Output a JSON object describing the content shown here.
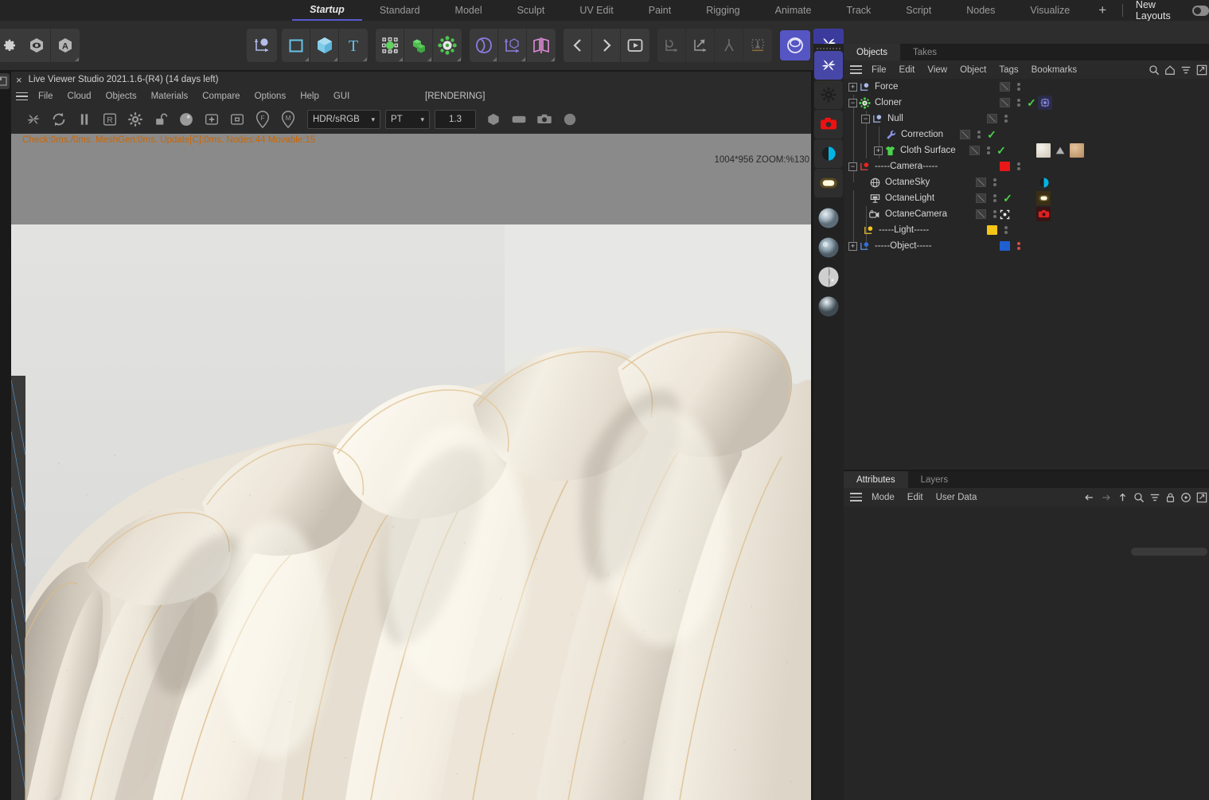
{
  "layout_tabs": {
    "items": [
      {
        "label": "Startup",
        "active": true
      },
      {
        "label": "Standard",
        "active": false
      },
      {
        "label": "Model",
        "active": false
      },
      {
        "label": "Sculpt",
        "active": false
      },
      {
        "label": "UV Edit",
        "active": false
      },
      {
        "label": "Paint",
        "active": false
      },
      {
        "label": "Rigging",
        "active": false
      },
      {
        "label": "Animate",
        "active": false
      },
      {
        "label": "Track",
        "active": false
      },
      {
        "label": "Script",
        "active": false
      },
      {
        "label": "Nodes",
        "active": false
      },
      {
        "label": "Visualize",
        "active": false
      }
    ],
    "add_label": "+",
    "new_layouts_label": "New Layouts"
  },
  "main_toolbar": {
    "groups": [
      {
        "name": "settings",
        "buttons": [
          {
            "icon": "gear-icon"
          }
        ]
      },
      {
        "name": "viewport-toggles",
        "buttons": [
          {
            "icon": "eye-icon"
          },
          {
            "icon": "letter-a-icon"
          }
        ]
      },
      {
        "name": "axis",
        "buttons": [
          {
            "icon": "axis-object-icon"
          }
        ]
      },
      {
        "name": "primitives",
        "buttons": [
          {
            "icon": "square-spline-icon"
          },
          {
            "icon": "cube-icon"
          },
          {
            "icon": "text-tool-icon"
          }
        ]
      },
      {
        "name": "generators",
        "buttons": [
          {
            "icon": "deformer-icon"
          },
          {
            "icon": "array-icon"
          },
          {
            "icon": "mograph-icon"
          }
        ]
      },
      {
        "name": "modifiers",
        "buttons": [
          {
            "icon": "spline-mask-icon"
          },
          {
            "icon": "coord-cube-icon"
          },
          {
            "icon": "plane-mirror-icon"
          }
        ]
      },
      {
        "name": "navigation",
        "buttons": [
          {
            "icon": "prev-frame-icon"
          },
          {
            "icon": "next-frame-icon"
          },
          {
            "icon": "render-view-icon"
          }
        ]
      },
      {
        "name": "transform",
        "buttons": [
          {
            "icon": "rotate-axis-icon"
          },
          {
            "icon": "scale-axis-icon"
          },
          {
            "icon": "merge-icon"
          },
          {
            "icon": "drop-icon"
          }
        ]
      },
      {
        "name": "render",
        "buttons": [
          {
            "icon": "render-sphere-icon"
          }
        ]
      },
      {
        "name": "octane",
        "buttons": [
          {
            "icon": "octane-logo-icon"
          }
        ]
      }
    ]
  },
  "live_viewer": {
    "title": "Live Viewer Studio 2021.1.6-(R4) (14 days left)",
    "close_label": "×",
    "menus": [
      "File",
      "Cloud",
      "Objects",
      "Materials",
      "Compare",
      "Options",
      "Help",
      "GUI"
    ],
    "rendering_status": "[RENDERING]",
    "toolbar_icons": [
      "octane-restart-icon",
      "refresh-icon",
      "pause-icon",
      "region-render-icon",
      "render-settings-icon",
      "lock-unlocked-icon",
      "sphere-preview-icon",
      "add-region-icon",
      "clear-region-icon",
      "focus-picker-icon",
      "material-picker-icon"
    ],
    "color_space": {
      "value": "HDR/sRGB",
      "chevron": "⌄"
    },
    "kernel": {
      "value": "PT",
      "chevron": "⌄"
    },
    "exposure": {
      "value": "1.3"
    },
    "right_icons": [
      "hexagon-icon",
      "rounded-rect-icon",
      "camera-icon",
      "circle-icon"
    ],
    "status_text": "Check:0ms./0ms. MeshGen:0ms. Update[C]:0ms. Nodes:44 Movable:15",
    "resolution_zoom": "1004*956 ZOOM:%130"
  },
  "vertical_strip": {
    "items": [
      {
        "name": "octane-logo-icon",
        "selected": true
      },
      {
        "name": "gear-icon",
        "selected": false
      },
      {
        "name": "camera-icon",
        "selected": false
      },
      {
        "name": "contrast-circle-icon",
        "selected": false
      },
      {
        "name": "light-icon",
        "selected": false
      },
      {
        "name": "material-sphere-1-icon",
        "selected": false
      },
      {
        "name": "material-sphere-2-icon",
        "selected": false
      },
      {
        "name": "material-sphere-3-icon",
        "selected": false
      },
      {
        "name": "material-sphere-4-icon",
        "selected": false
      }
    ]
  },
  "object_manager": {
    "tabs": [
      {
        "label": "Objects",
        "active": true
      },
      {
        "label": "Takes",
        "active": false
      }
    ],
    "menus": [
      "File",
      "Edit",
      "View",
      "Object",
      "Tags",
      "Bookmarks"
    ],
    "header_icons": [
      "search-icon",
      "home-icon",
      "filter-icon",
      "expand-icon"
    ],
    "tree": [
      {
        "label": "Force",
        "depth": 0,
        "expander": "+",
        "icon": "null-object-icon",
        "icon_color": "#a9b6e8",
        "checkbox": true,
        "dots": "gray",
        "visible_tick": false,
        "color_box": null,
        "tags": []
      },
      {
        "label": "Cloner",
        "depth": 0,
        "expander": "-",
        "icon": "mograph-cloner-icon",
        "icon_color": "#4ad24a",
        "checkbox": true,
        "dots": "gray",
        "visible_tick": true,
        "color_box": null,
        "tags": [
          {
            "type": "mograph-tag",
            "color": "#6a6ad8"
          }
        ]
      },
      {
        "label": "Null",
        "depth": 1,
        "expander": "-",
        "icon": "null-object-icon",
        "icon_color": "#a9b6e8",
        "checkbox": true,
        "dots": "gray",
        "visible_tick": false,
        "color_box": null,
        "tags": []
      },
      {
        "label": "Correction",
        "depth": 2,
        "expander": "",
        "icon": "wrench-icon",
        "icon_color": "#8a95e8",
        "checkbox": true,
        "dots": "gray",
        "visible_tick": true,
        "color_box": null,
        "tags": []
      },
      {
        "label": "Cloth Surface",
        "depth": 2,
        "expander": "+",
        "icon": "cloth-shirt-icon",
        "icon_color": "#4ad24a",
        "checkbox": true,
        "dots": "gray",
        "visible_tick": true,
        "color_box": null,
        "tags": [
          {
            "type": "material-thumb-white",
            "color": "#e4ddd3"
          },
          {
            "type": "phong-triangle-tag",
            "color": "#9a9a9a"
          },
          {
            "type": "material-thumb-tan",
            "color": "#cda77f"
          }
        ]
      },
      {
        "label": "-----Camera-----",
        "depth": 0,
        "expander": "-",
        "icon": "null-red-icon",
        "icon_color": "#e03030",
        "checkbox": false,
        "dots": "gray",
        "visible_tick": false,
        "color_box": "#e81818",
        "tags": []
      },
      {
        "label": "OctaneSky",
        "depth": 1,
        "expander": "",
        "icon": "octane-sky-icon",
        "icon_color": "#c8c8c8",
        "checkbox": true,
        "dots": "gray",
        "visible_tick": false,
        "color_box": null,
        "tags": [
          {
            "type": "sky-tag",
            "color": "#00b4e6"
          }
        ]
      },
      {
        "label": "OctaneLight",
        "depth": 1,
        "expander": "",
        "icon": "octane-light-icon",
        "icon_color": "#c8c8c8",
        "checkbox": true,
        "dots": "gray",
        "visible_tick": true,
        "color_box": null,
        "tags": [
          {
            "type": "light-tag",
            "color": "#fff6d0"
          }
        ]
      },
      {
        "label": "OctaneCamera",
        "depth": 1,
        "expander": "",
        "icon": "octane-camera-icon",
        "icon_color": "#c8c8c8",
        "checkbox": true,
        "dots": "gray",
        "visible_tick": false,
        "color_box": null,
        "tags": [
          {
            "type": "camera-tag",
            "color": "#e02020"
          }
        ],
        "special_icon": "target-icon"
      },
      {
        "label": "-----Light-----",
        "depth": 0,
        "expander": "",
        "icon": "null-yellow-icon",
        "icon_color": "#f0c020",
        "checkbox": false,
        "dots": "gray",
        "visible_tick": false,
        "color_box": "#f5c518",
        "tags": []
      },
      {
        "label": "-----Object-----",
        "depth": 0,
        "expander": "+",
        "icon": "null-blue-icon",
        "icon_color": "#3a7adf",
        "checkbox": false,
        "dots": "red",
        "visible_tick": false,
        "color_box": "#1f5fd0",
        "tags": []
      }
    ]
  },
  "attribute_manager": {
    "tabs": [
      {
        "label": "Attributes",
        "active": true
      },
      {
        "label": "Layers",
        "active": false
      }
    ],
    "menus": [
      "Mode",
      "Edit",
      "User Data"
    ],
    "header_icons": [
      "arrow-left-icon",
      "arrow-right-icon",
      "arrow-up-icon",
      "search-icon",
      "filter-icon",
      "lock-icon",
      "target-icon",
      "expand-icon"
    ]
  },
  "colors": {
    "accent_blue": "#5555c4",
    "status_orange": "#cc6600",
    "tick_green": "#4ad24a",
    "panel_bg": "#262626",
    "toolbar_bg": "#2d2d2d",
    "viewport_gray": "#8a8a8a"
  }
}
